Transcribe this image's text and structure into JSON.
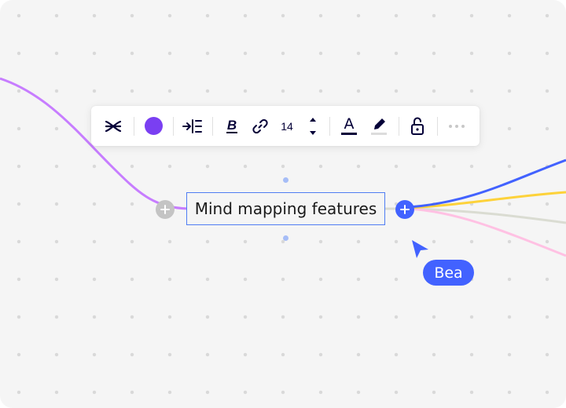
{
  "canvas": {
    "background": "#f5f5f5",
    "dot_color": "#d9d9d9"
  },
  "branches": [
    {
      "name": "parent-branch",
      "color": "#c77dff"
    },
    {
      "name": "child-branch-blue",
      "color": "#4262ff"
    },
    {
      "name": "child-branch-yellow",
      "color": "#fdd23a"
    },
    {
      "name": "child-branch-gray",
      "color": "#dadcd2"
    },
    {
      "name": "child-branch-pink",
      "color": "#ffc1e3"
    }
  ],
  "toolbar": {
    "items": [
      {
        "name": "mind-map-style-button",
        "icon": "branch-style-icon"
      },
      {
        "name": "color-picker-button",
        "icon": "color-swatch-icon",
        "color": "#7a3ff2"
      },
      {
        "name": "layout-button",
        "icon": "align-layout-icon"
      },
      {
        "name": "bold-button",
        "icon": "bold-icon",
        "label": "B"
      },
      {
        "name": "link-button",
        "icon": "link-icon"
      },
      {
        "name": "font-size-stepper",
        "value": "14"
      },
      {
        "name": "text-color-button",
        "icon": "text-color-icon",
        "label": "A"
      },
      {
        "name": "highlight-button",
        "icon": "highlighter-icon"
      },
      {
        "name": "lock-button",
        "icon": "unlock-icon"
      },
      {
        "name": "more-button",
        "icon": "more-icon"
      }
    ],
    "font_size": "14",
    "bold_label": "B",
    "text_color_label": "A"
  },
  "node": {
    "text": "Mind mapping features",
    "border_color": "#4f7df3"
  },
  "collaborator": {
    "name": "Bea",
    "color": "#4262ff"
  }
}
